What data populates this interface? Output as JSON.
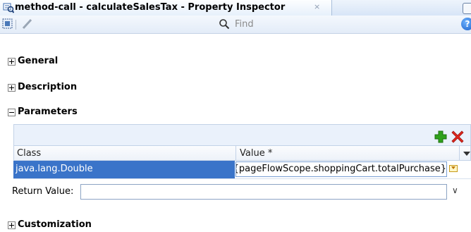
{
  "window": {
    "title": "method-call - calculateSalesTax - Property Inspector",
    "close_symbol": "×"
  },
  "toolbar": {
    "find_placeholder": "Find",
    "help_label": "?"
  },
  "sections": [
    {
      "label": "General",
      "expanded": false
    },
    {
      "label": "Description",
      "expanded": false
    },
    {
      "label": "Parameters",
      "expanded": true
    },
    {
      "label": "Customization",
      "expanded": false
    }
  ],
  "parameters": {
    "columns": [
      "Class",
      "Value *"
    ],
    "rows": [
      {
        "class": "java.lang.Double",
        "value": "#{pageFlowScope.shoppingCart.totalPurchase}"
      }
    ],
    "return_value_label": "Return Value:",
    "return_value": ""
  },
  "colors": {
    "selection": "#3a74c9",
    "add_icon": "#2fa11b",
    "delete_icon": "#e1261c"
  },
  "icons": [
    "property-inspector-icon",
    "binding-icon",
    "edit-icon",
    "search-icon",
    "help-icon",
    "add-icon",
    "delete-icon",
    "expression-builder-icon",
    "dropdown-icon"
  ]
}
